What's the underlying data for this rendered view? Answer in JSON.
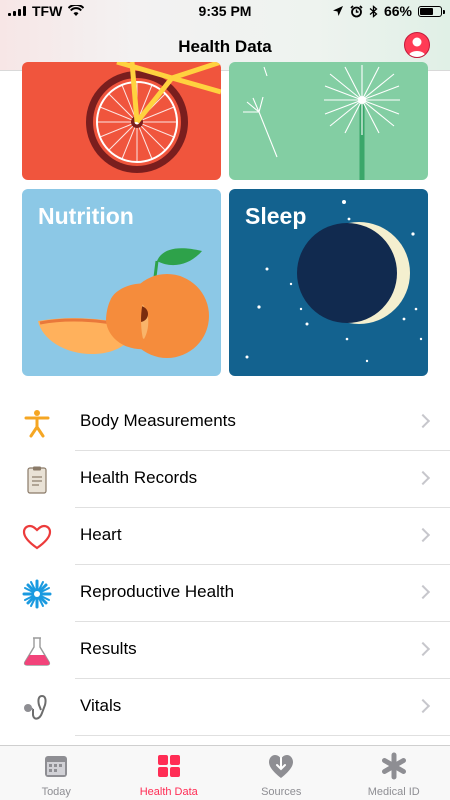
{
  "status": {
    "carrier": "TFW",
    "time": "9:35 PM",
    "battery": "66%",
    "battery_level": 0.66
  },
  "header": {
    "title": "Health Data"
  },
  "tiles": {
    "nutrition": "Nutrition",
    "sleep": "Sleep"
  },
  "list": {
    "items": [
      {
        "label": "Body Measurements",
        "icon": "figure-icon"
      },
      {
        "label": "Health Records",
        "icon": "clipboard-icon"
      },
      {
        "label": "Heart",
        "icon": "heart-icon"
      },
      {
        "label": "Reproductive Health",
        "icon": "snowflake-icon"
      },
      {
        "label": "Results",
        "icon": "flask-icon"
      },
      {
        "label": "Vitals",
        "icon": "stethoscope-icon"
      }
    ]
  },
  "tabbar": {
    "tabs": [
      {
        "label": "Today",
        "icon": "calendar-icon"
      },
      {
        "label": "Health Data",
        "icon": "grid-icon",
        "active": true
      },
      {
        "label": "Sources",
        "icon": "heart-arrow-icon"
      },
      {
        "label": "Medical ID",
        "icon": "asterisk-icon"
      }
    ]
  },
  "colors": {
    "accent": "#ff2d55",
    "activity": "#f0553d",
    "mindfulness": "#83cea3",
    "nutrition": "#8cc8e6",
    "sleep": "#13628f"
  }
}
